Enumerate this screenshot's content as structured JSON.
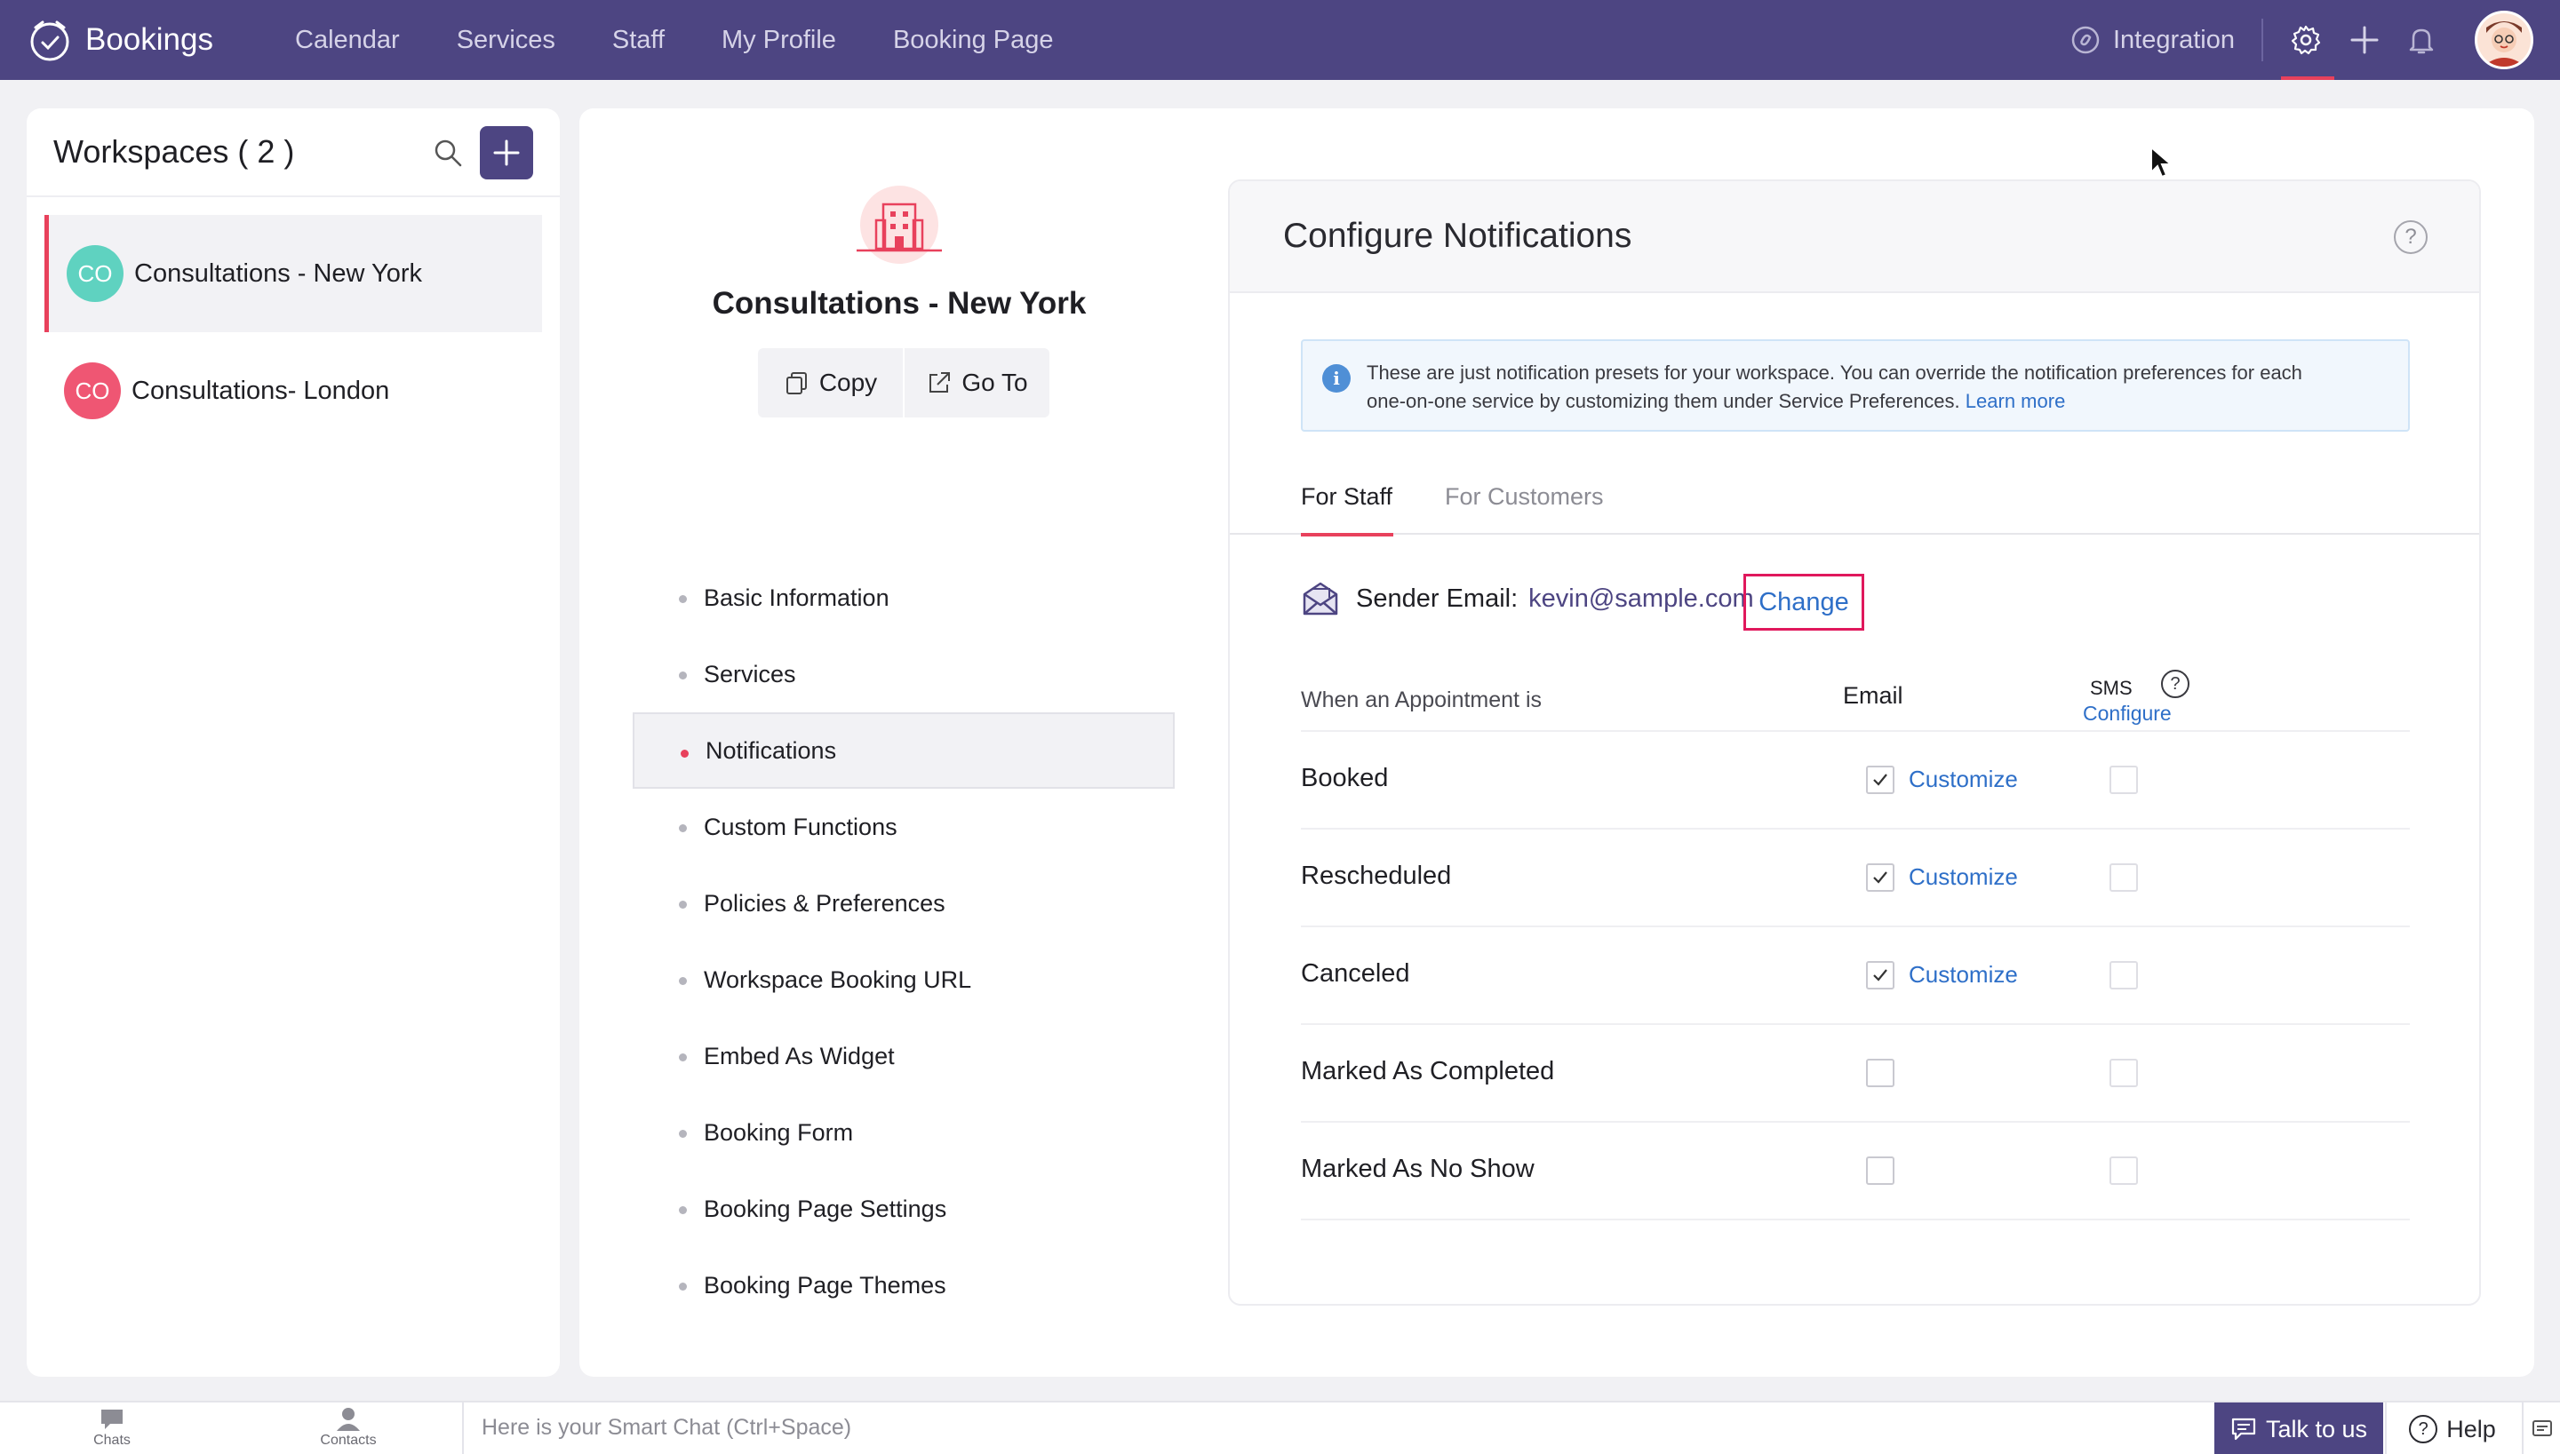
{
  "app": {
    "title": "Bookings"
  },
  "nav": {
    "items": [
      "Calendar",
      "Services",
      "Staff",
      "My Profile",
      "Booking Page"
    ],
    "integration_label": "Integration"
  },
  "workspaces": {
    "title": "Workspaces ( 2 )",
    "items": [
      {
        "initials": "CO",
        "name": "Consultations - New York",
        "color": "#5fd2c0",
        "active": true
      },
      {
        "initials": "CO",
        "name": "Consultations- London",
        "color": "#ef5673",
        "active": false
      }
    ]
  },
  "workspace": {
    "title": "Consultations - New York",
    "copy_label": "Copy",
    "goto_label": "Go To"
  },
  "menu": {
    "items": [
      "Basic Information",
      "Services",
      "Notifications",
      "Custom Functions",
      "Policies & Preferences",
      "Workspace Booking URL",
      "Embed As Widget",
      "Booking Form",
      "Booking Page Settings",
      "Booking Page Themes"
    ],
    "active_index": 2
  },
  "configure": {
    "title": "Configure Notifications",
    "help_glyph": "?",
    "info_glyph": "i",
    "info_text_1": "These are just notification presets for your workspace. You can override the notification preferences for each",
    "info_text_2": "one-on-one service by customizing them under Service Preferences.",
    "learn_more": "Learn more",
    "tabs": [
      "For Staff",
      "For Customers"
    ],
    "sender_label": "Sender Email:",
    "sender_value": "kevin@sample.com",
    "change_label": "Change",
    "table": {
      "col_when": "When an Appointment is",
      "col_email": "Email",
      "col_sms": "SMS",
      "sms_help": "?",
      "sms_configure": "Configure",
      "customize_label": "Customize",
      "rows": [
        {
          "label": "Booked",
          "email": true,
          "sms": false
        },
        {
          "label": "Rescheduled",
          "email": true,
          "sms": false
        },
        {
          "label": "Canceled",
          "email": true,
          "sms": false
        },
        {
          "label": "Marked As Completed",
          "email": false,
          "sms": false
        },
        {
          "label": "Marked As No Show",
          "email": false,
          "sms": false
        }
      ]
    }
  },
  "bottom": {
    "chats": "Chats",
    "contacts": "Contacts",
    "smart_chat": "Here is your Smart Chat (Ctrl+Space)",
    "talk": "Talk to us",
    "help": "Help",
    "help_glyph": "?"
  },
  "colors": {
    "brand": "#4d4582",
    "accent": "#e8415c",
    "link": "#2e6fc8"
  }
}
